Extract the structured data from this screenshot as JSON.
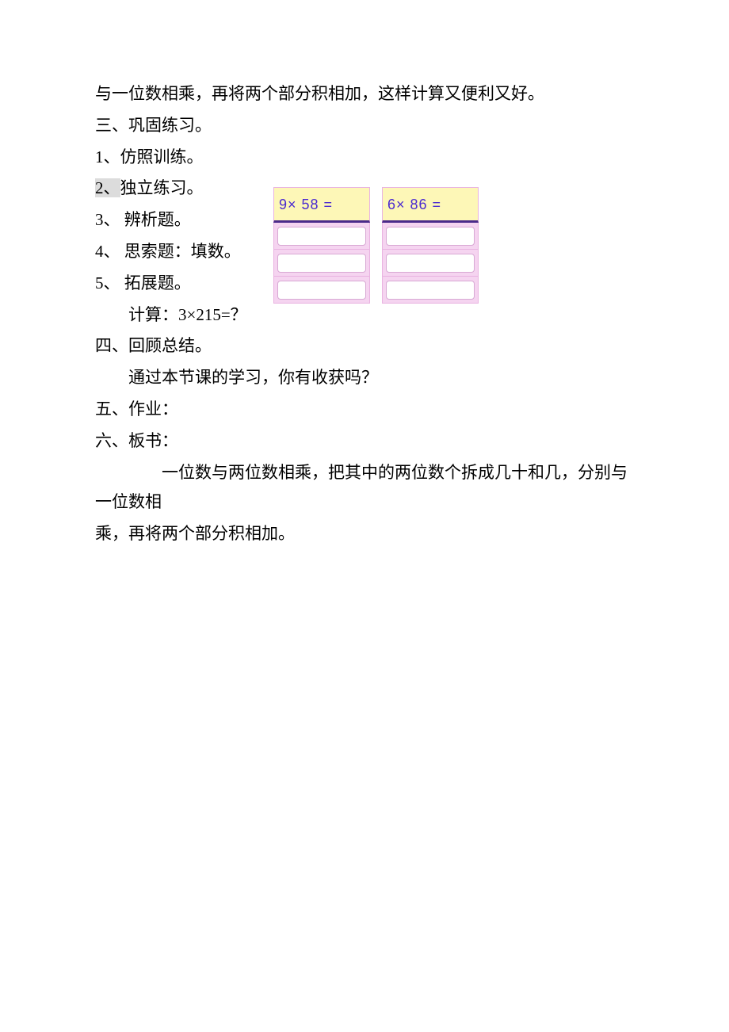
{
  "lines": {
    "l1": "与一位数相乘，再将两个部分积相加，这样计算又便利又好。",
    "l2": "三、巩固练习。",
    "l3": "1、仿照训练。",
    "l4a": "2、",
    "l4b": "独立练习。",
    "l5": "3、 辨析题。",
    "l6": "4、 思索题：填数。",
    "l7": "5、 拓展题。",
    "l8": "计算：3×215=？",
    "l9": "四、回顾总结。",
    "l10": "通过本节课的学习，你有收获吗？",
    "l11": "五、作业：",
    "l12": "六、板书：",
    "l13": "一位数与两位数相乘，把其中的两位数个拆成几十和几，分别与一位数相",
    "l14": "乘，再将两个部分积相加。"
  },
  "problems": {
    "p1": "9× 58 =",
    "p2": "6× 86 ="
  }
}
